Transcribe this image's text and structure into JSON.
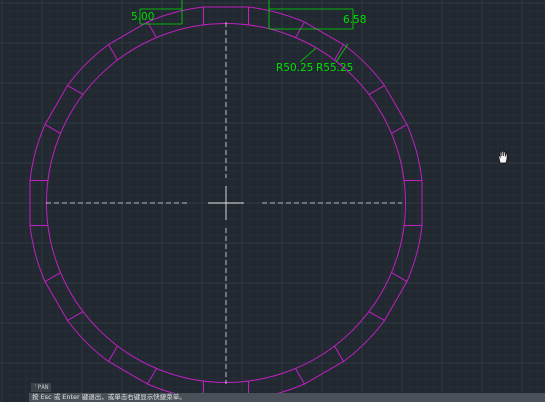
{
  "colors": {
    "background": "#212830",
    "grid_minor": "#262e37",
    "grid_major": "#2e3843",
    "outline": "#c020c0",
    "dimension": "#00e000",
    "centerline": "#e8e8e8"
  },
  "drawing": {
    "dimensions": {
      "width_left": "5.00",
      "width_right": "6.58",
      "inner_radius": "R50.25",
      "outer_radius": "R55.25"
    }
  },
  "command_line": {
    "history": "'PAN",
    "prompt": "按 Esc 或 Enter 键退出，或单击右键显示快捷菜单。"
  },
  "cursor": {
    "icon": "pan-hand-icon"
  }
}
